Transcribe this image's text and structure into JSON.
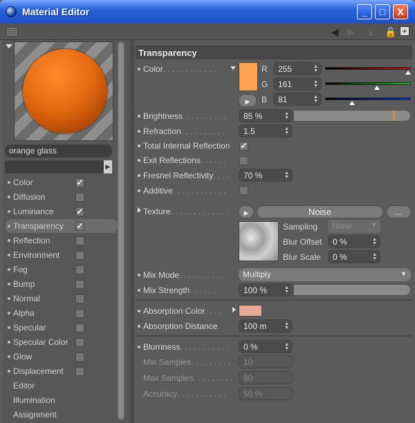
{
  "window": {
    "title": "Material Editor",
    "min": "_",
    "max": "□",
    "close": "X"
  },
  "material": {
    "name": "orange glass",
    "preview_icon": "sphere-preview"
  },
  "channels": [
    {
      "label": "Color",
      "checked": true
    },
    {
      "label": "Diffusion",
      "checked": false
    },
    {
      "label": "Luminance",
      "checked": true
    },
    {
      "label": "Transparency",
      "checked": true
    },
    {
      "label": "Reflection",
      "checked": false
    },
    {
      "label": "Environment",
      "checked": false
    },
    {
      "label": "Fog",
      "checked": false
    },
    {
      "label": "Bump",
      "checked": false
    },
    {
      "label": "Normal",
      "checked": false
    },
    {
      "label": "Alpha",
      "checked": false
    },
    {
      "label": "Specular",
      "checked": false
    },
    {
      "label": "Specular Color",
      "checked": false
    },
    {
      "label": "Glow",
      "checked": false
    },
    {
      "label": "Displacement",
      "checked": false
    },
    {
      "label": "Editor"
    },
    {
      "label": "Illumination"
    },
    {
      "label": "Assignment"
    }
  ],
  "transparency": {
    "header": "Transparency",
    "color_label": "Color",
    "swatch": "#ffa151",
    "r_label": "R",
    "r": "255",
    "g_label": "G",
    "g": "161",
    "b_label": "B",
    "b": "81",
    "brightness_label": "Brightness",
    "brightness": "85 %",
    "brightness_level": 0.85,
    "refraction_label": "Refraction",
    "refraction": "1.5",
    "tir_label": "Total Internal Reflection",
    "tir_checked": true,
    "exit_label": "Exit Reflections",
    "exit_checked": false,
    "fresnel_label": "Fresnel Reflectivity",
    "fresnel": "70 %",
    "additive_label": "Additive",
    "additive_checked": false,
    "texture_label": "Texture",
    "texture_name": "Noise",
    "texture_more": "...",
    "sampling_label": "Sampling",
    "sampling": "None",
    "blur_offset_label": "Blur Offset",
    "blur_offset": "0 %",
    "blur_scale_label": "Blur Scale",
    "blur_scale": "0 %",
    "mix_mode_label": "Mix Mode",
    "mix_mode": "Multiply",
    "mix_strength_label": "Mix Strength",
    "mix_strength": "100 %",
    "mix_strength_level": 1.0,
    "abs_color_label": "Absorption Color",
    "abs_color": "#e8a995",
    "abs_distance_label": "Absorption Distance",
    "abs_distance": "100 m",
    "blurriness_label": "Blurriness",
    "blurriness": "0 %",
    "min_samples_label": "Min Samples",
    "min_samples": "10",
    "max_samples_label": "Max Samples",
    "max_samples": "80",
    "accuracy_label": "Accuracy",
    "accuracy": "50 %"
  }
}
